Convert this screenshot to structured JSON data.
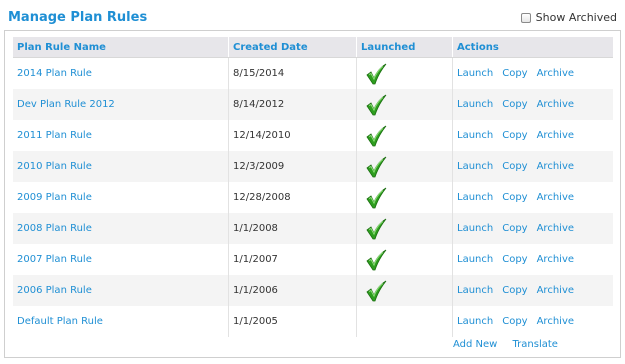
{
  "header": {
    "title": "Manage Plan Rules",
    "show_archived_label": "Show Archived"
  },
  "table": {
    "columns": [
      "Plan Rule Name",
      "Created Date",
      "Launched",
      "Actions"
    ],
    "rows": [
      {
        "name": "2014 Plan Rule",
        "date": "8/15/2014",
        "launched": true
      },
      {
        "name": "Dev Plan Rule 2012",
        "date": "8/14/2012",
        "launched": true
      },
      {
        "name": "2011 Plan Rule",
        "date": "12/14/2010",
        "launched": true
      },
      {
        "name": "2010 Plan Rule",
        "date": "12/3/2009",
        "launched": true
      },
      {
        "name": "2009 Plan Rule",
        "date": "12/28/2008",
        "launched": true
      },
      {
        "name": "2008 Plan Rule",
        "date": "1/1/2008",
        "launched": true
      },
      {
        "name": "2007 Plan Rule",
        "date": "1/1/2007",
        "launched": true
      },
      {
        "name": "2006 Plan Rule",
        "date": "1/1/2006",
        "launched": true
      },
      {
        "name": "Default Plan Rule",
        "date": "1/1/2005",
        "launched": false
      }
    ],
    "row_actions": {
      "launch": "Launch",
      "copy": "Copy",
      "archive": "Archive"
    }
  },
  "footer": {
    "add_new": "Add New",
    "translate": "Translate"
  },
  "icons": {
    "launched": "green-checkmark-icon"
  },
  "colors": {
    "accent": "#1f8fd4",
    "header_bg": "#e7e6ea",
    "check_green": "#2e9e1f"
  }
}
